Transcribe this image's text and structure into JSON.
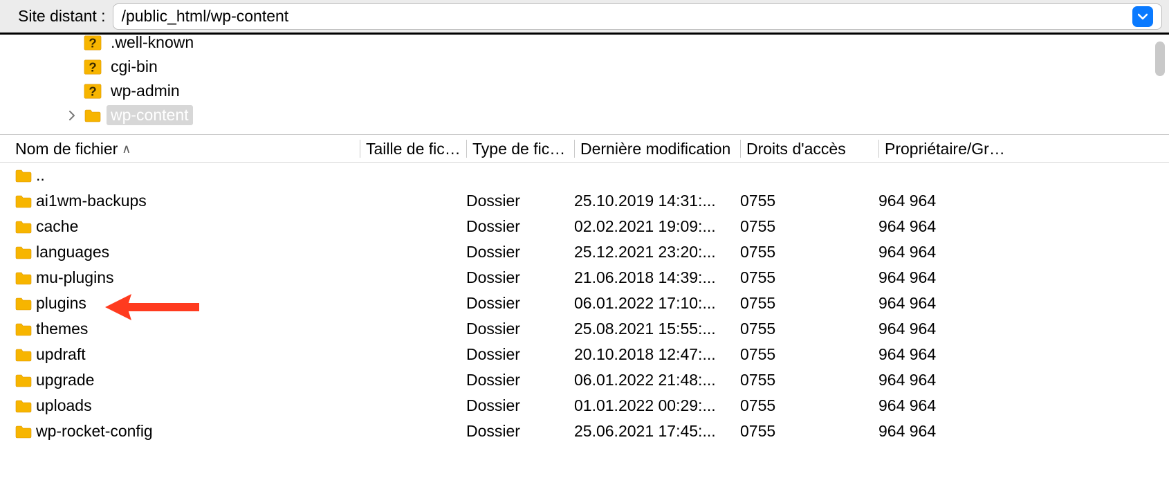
{
  "pathbar": {
    "label": "Site distant :",
    "value": "/public_html/wp-content"
  },
  "tree": {
    "items": [
      {
        "name": ".well-known",
        "icon": "question",
        "selected": false,
        "expandable": false
      },
      {
        "name": "cgi-bin",
        "icon": "question",
        "selected": false,
        "expandable": false
      },
      {
        "name": "wp-admin",
        "icon": "question",
        "selected": false,
        "expandable": false
      },
      {
        "name": "wp-content",
        "icon": "folder",
        "selected": true,
        "expandable": true
      }
    ]
  },
  "columns": {
    "name": "Nom de fichier",
    "size": "Taille de fichier",
    "type": "Type de fichier",
    "mod": "Dernière modification",
    "perm": "Droits d'accès",
    "owner": "Propriétaire/Groupe",
    "sort_indicator": "∧"
  },
  "list": {
    "parent": "..",
    "rows": [
      {
        "name": "ai1wm-backups",
        "type": "Dossier",
        "mod": "25.10.2019 14:31:...",
        "perm": "0755",
        "owner": "964 964"
      },
      {
        "name": "cache",
        "type": "Dossier",
        "mod": "02.02.2021 19:09:...",
        "perm": "0755",
        "owner": "964 964"
      },
      {
        "name": "languages",
        "type": "Dossier",
        "mod": "25.12.2021 23:20:...",
        "perm": "0755",
        "owner": "964 964"
      },
      {
        "name": "mu-plugins",
        "type": "Dossier",
        "mod": "21.06.2018 14:39:...",
        "perm": "0755",
        "owner": "964 964"
      },
      {
        "name": "plugins",
        "type": "Dossier",
        "mod": "06.01.2022 17:10:...",
        "perm": "0755",
        "owner": "964 964"
      },
      {
        "name": "themes",
        "type": "Dossier",
        "mod": "25.08.2021 15:55:...",
        "perm": "0755",
        "owner": "964 964"
      },
      {
        "name": "updraft",
        "type": "Dossier",
        "mod": "20.10.2018 12:47:...",
        "perm": "0755",
        "owner": "964 964"
      },
      {
        "name": "upgrade",
        "type": "Dossier",
        "mod": "06.01.2022 21:48:...",
        "perm": "0755",
        "owner": "964 964"
      },
      {
        "name": "uploads",
        "type": "Dossier",
        "mod": "01.01.2022 00:29:...",
        "perm": "0755",
        "owner": "964 964"
      },
      {
        "name": "wp-rocket-config",
        "type": "Dossier",
        "mod": "25.06.2021 17:45:...",
        "perm": "0755",
        "owner": "964 964"
      }
    ]
  }
}
